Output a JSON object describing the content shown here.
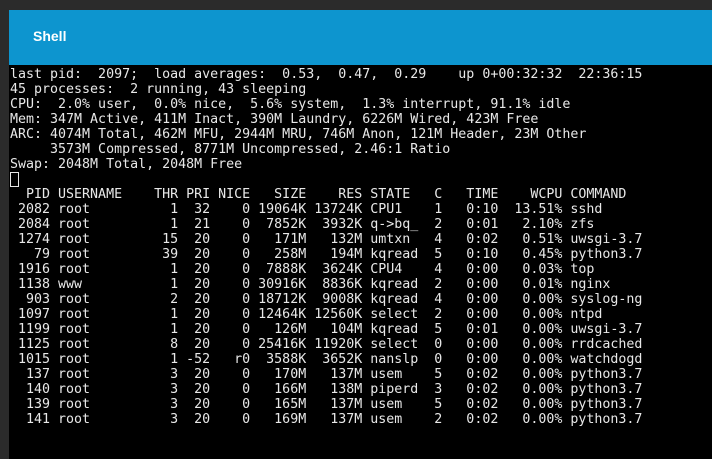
{
  "window": {
    "title": "Shell"
  },
  "summary": [
    "last pid:  2097;  load averages:  0.53,  0.47,  0.29    up 0+00:32:32  22:36:15",
    "45 processes:  2 running, 43 sleeping",
    "CPU:  2.0% user,  0.0% nice,  5.6% system,  1.3% interrupt, 91.1% idle",
    "Mem: 347M Active, 411M Inact, 390M Laundry, 6226M Wired, 423M Free",
    "ARC: 4074M Total, 462M MFU, 2944M MRU, 746M Anon, 121M Header, 23M Other",
    "     3573M Compressed, 8771M Uncompressed, 2.46:1 Ratio",
    "Swap: 2048M Total, 2048M Free"
  ],
  "table": {
    "header": "  PID USERNAME    THR PRI NICE   SIZE    RES STATE   C   TIME    WCPU COMMAND",
    "rows": [
      " 2082 root          1  32    0 19064K 13724K CPU1    1   0:10  13.51% sshd",
      " 2084 root          1  21    0  7852K  3932K q->bq_  2   0:01   2.10% zfs",
      " 1274 root         15  20    0   171M   132M umtxn   4   0:02   0.51% uwsgi-3.7",
      "   79 root         39  20    0   258M   194M kqread  5   0:10   0.45% python3.7",
      " 1916 root          1  20    0  7888K  3624K CPU4    4   0:00   0.03% top",
      " 1138 www           1  20    0 30916K  8836K kqread  2   0:00   0.01% nginx",
      "  903 root          2  20    0 18712K  9008K kqread  4   0:00   0.00% syslog-ng",
      " 1097 root          1  20    0 12464K 12560K select  2   0:00   0.00% ntpd",
      " 1199 root          1  20    0   126M   104M kqread  5   0:01   0.00% uwsgi-3.7",
      " 1125 root          8  20    0 25416K 11920K select  0   0:00   0.00% rrdcached",
      " 1015 root          1 -52   r0  3588K  3652K nanslp  0   0:00   0.00% watchdogd",
      "  137 root          3  20    0   170M   137M usem    5   0:02   0.00% python3.7",
      "  140 root          3  20    0   166M   138M piperd  3   0:02   0.00% python3.7",
      "  139 root          3  20    0   165M   137M usem    5   0:02   0.00% python3.7",
      "  141 root          3  20    0   169M   137M usem    2   0:02   0.00% python3.7"
    ]
  }
}
